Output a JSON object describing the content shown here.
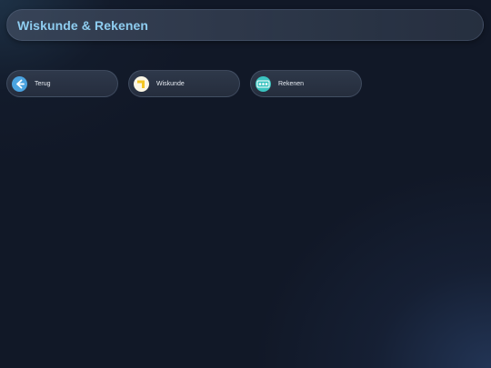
{
  "header": {
    "title": "Wiskunde & Rekenen"
  },
  "nav": {
    "items": [
      {
        "label": "Terug",
        "icon": "back-arrow-icon",
        "color": "#4aa3e0"
      },
      {
        "label": "Wiskunde",
        "icon": "geometry-icon",
        "color": "#f3c623"
      },
      {
        "label": "Rekenen",
        "icon": "abacus-icon",
        "color": "#3bc4c0"
      }
    ]
  }
}
